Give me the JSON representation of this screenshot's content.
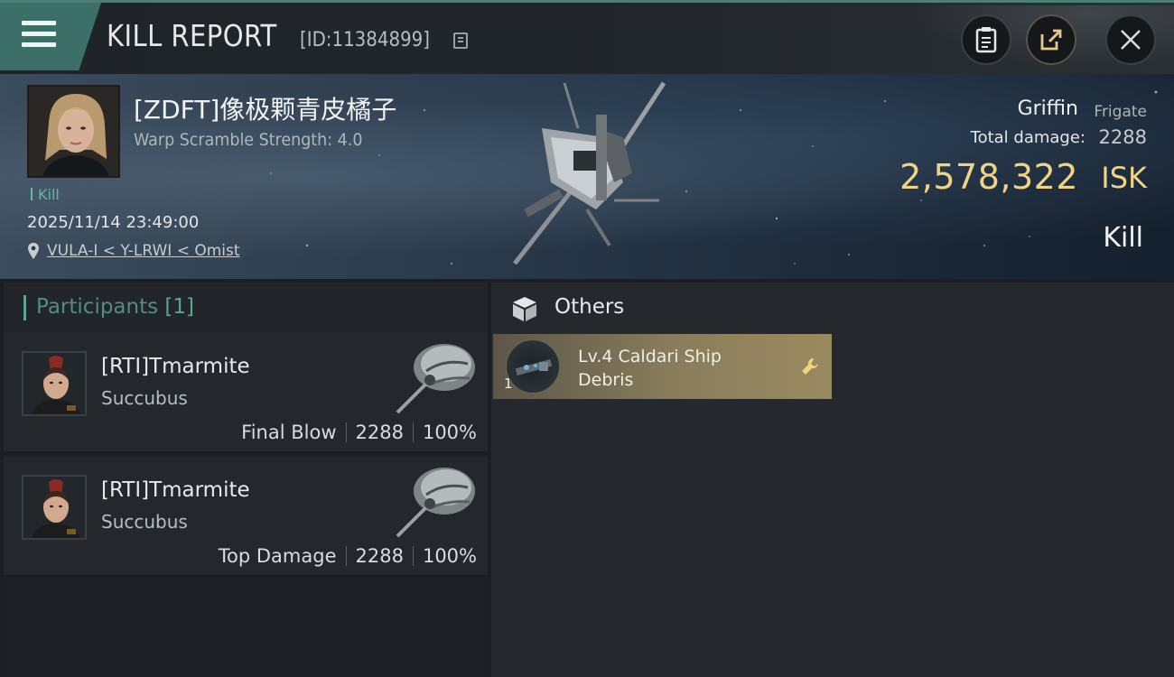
{
  "header": {
    "title": "KILL REPORT",
    "report_id": "[ID:11384899]",
    "icons": [
      "menu-icon",
      "copy-icon",
      "clipboard-icon",
      "share-icon",
      "close-icon"
    ]
  },
  "victim": {
    "name": "[ZDFT]像极颗青皮橘子",
    "warp_scramble": "Warp Scramble Strength: 4.0",
    "tag": "Kill",
    "datetime": "2025/11/14 23:49:00",
    "location": "VULA-I < Y-LRWI < Omist",
    "ship_name": "Griffin",
    "ship_class": "Frigate",
    "total_damage_label": "Total damage:",
    "total_damage_value": "2288",
    "isk_value": "2,578,322",
    "isk_unit": "ISK",
    "status": "Kill"
  },
  "participants": {
    "label": "Participants",
    "count": "[1]",
    "rows": [
      {
        "name": "[RTI]Tmarmite",
        "ship": "Succubus",
        "role": "Final Blow",
        "damage": "2288",
        "percent": "100%"
      },
      {
        "name": "[RTI]Tmarmite",
        "ship": "Succubus",
        "role": "Top Damage",
        "damage": "2288",
        "percent": "100%"
      }
    ]
  },
  "others": {
    "title": "Others",
    "items": [
      {
        "name": "Lv.4 Caldari Ship Debris",
        "quantity": "1"
      }
    ]
  },
  "colors": {
    "accent": "#3c6f68",
    "isk": "#f0d486",
    "participant_label": "#4f8f83",
    "item_card": "#8a7e5c"
  }
}
